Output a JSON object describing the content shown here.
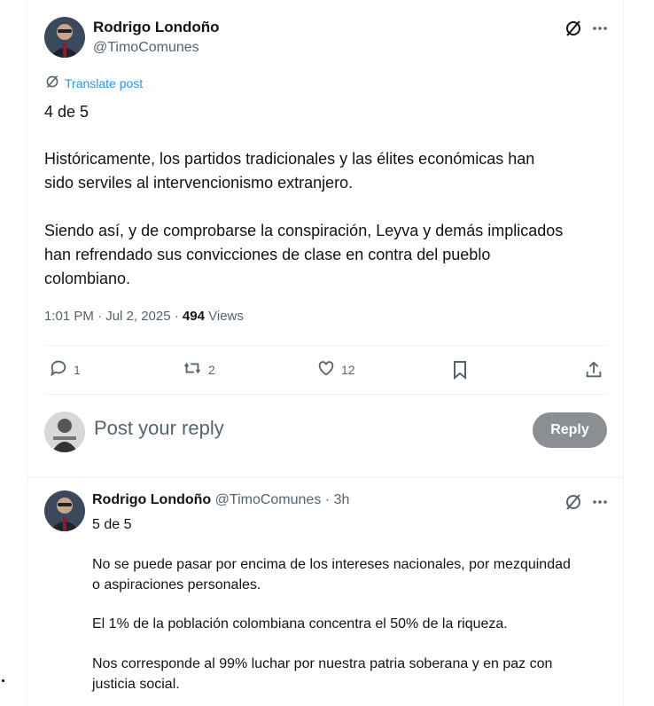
{
  "main_post": {
    "author_name": "Rodrigo Londoño",
    "author_handle": "@TimoComunes",
    "translate_label": "Translate post",
    "paragraphs": [
      "4 de 5",
      "Históricamente, los partidos tradicionales y las élites económicas han",
      "sido serviles al intervencionismo extranjero.",
      "Siendo así, y de comprobarse la conspiración, Leyva y demás implicados",
      "han refrendado sus convicciones de clase en contra del pueblo",
      "colombiano."
    ],
    "time": "1:01 PM · Jul 2, 2025 ·",
    "views_count": "494",
    "views_label": "Views",
    "actions": {
      "replies": "1",
      "reposts": "2",
      "likes": "12"
    }
  },
  "reply_box": {
    "placeholder": "Post your reply",
    "button_label": "Reply"
  },
  "second_post": {
    "author_name": "Rodrigo Londoño",
    "author_handle": "@TimoComunes",
    "time_sep": "·",
    "time": "3h",
    "lines": [
      "5 de 5",
      "No se puede pasar por encima de los intereses nacionales, por mezquindad",
      "o aspiraciones personales.",
      "El 1% de la población colombiana concentra el 50% de la riqueza.",
      "Nos corresponde al 99% luchar por nuestra patria soberana y en paz con",
      "justicia social."
    ]
  },
  "colors": {
    "accent": "#1d9bf0",
    "muted": "#536471",
    "reply_button": "#8b8f93"
  },
  "icons": [
    "grok-icon",
    "more-icon",
    "translate-icon",
    "reply-icon",
    "repost-icon",
    "like-icon",
    "bookmark-icon",
    "share-icon"
  ]
}
